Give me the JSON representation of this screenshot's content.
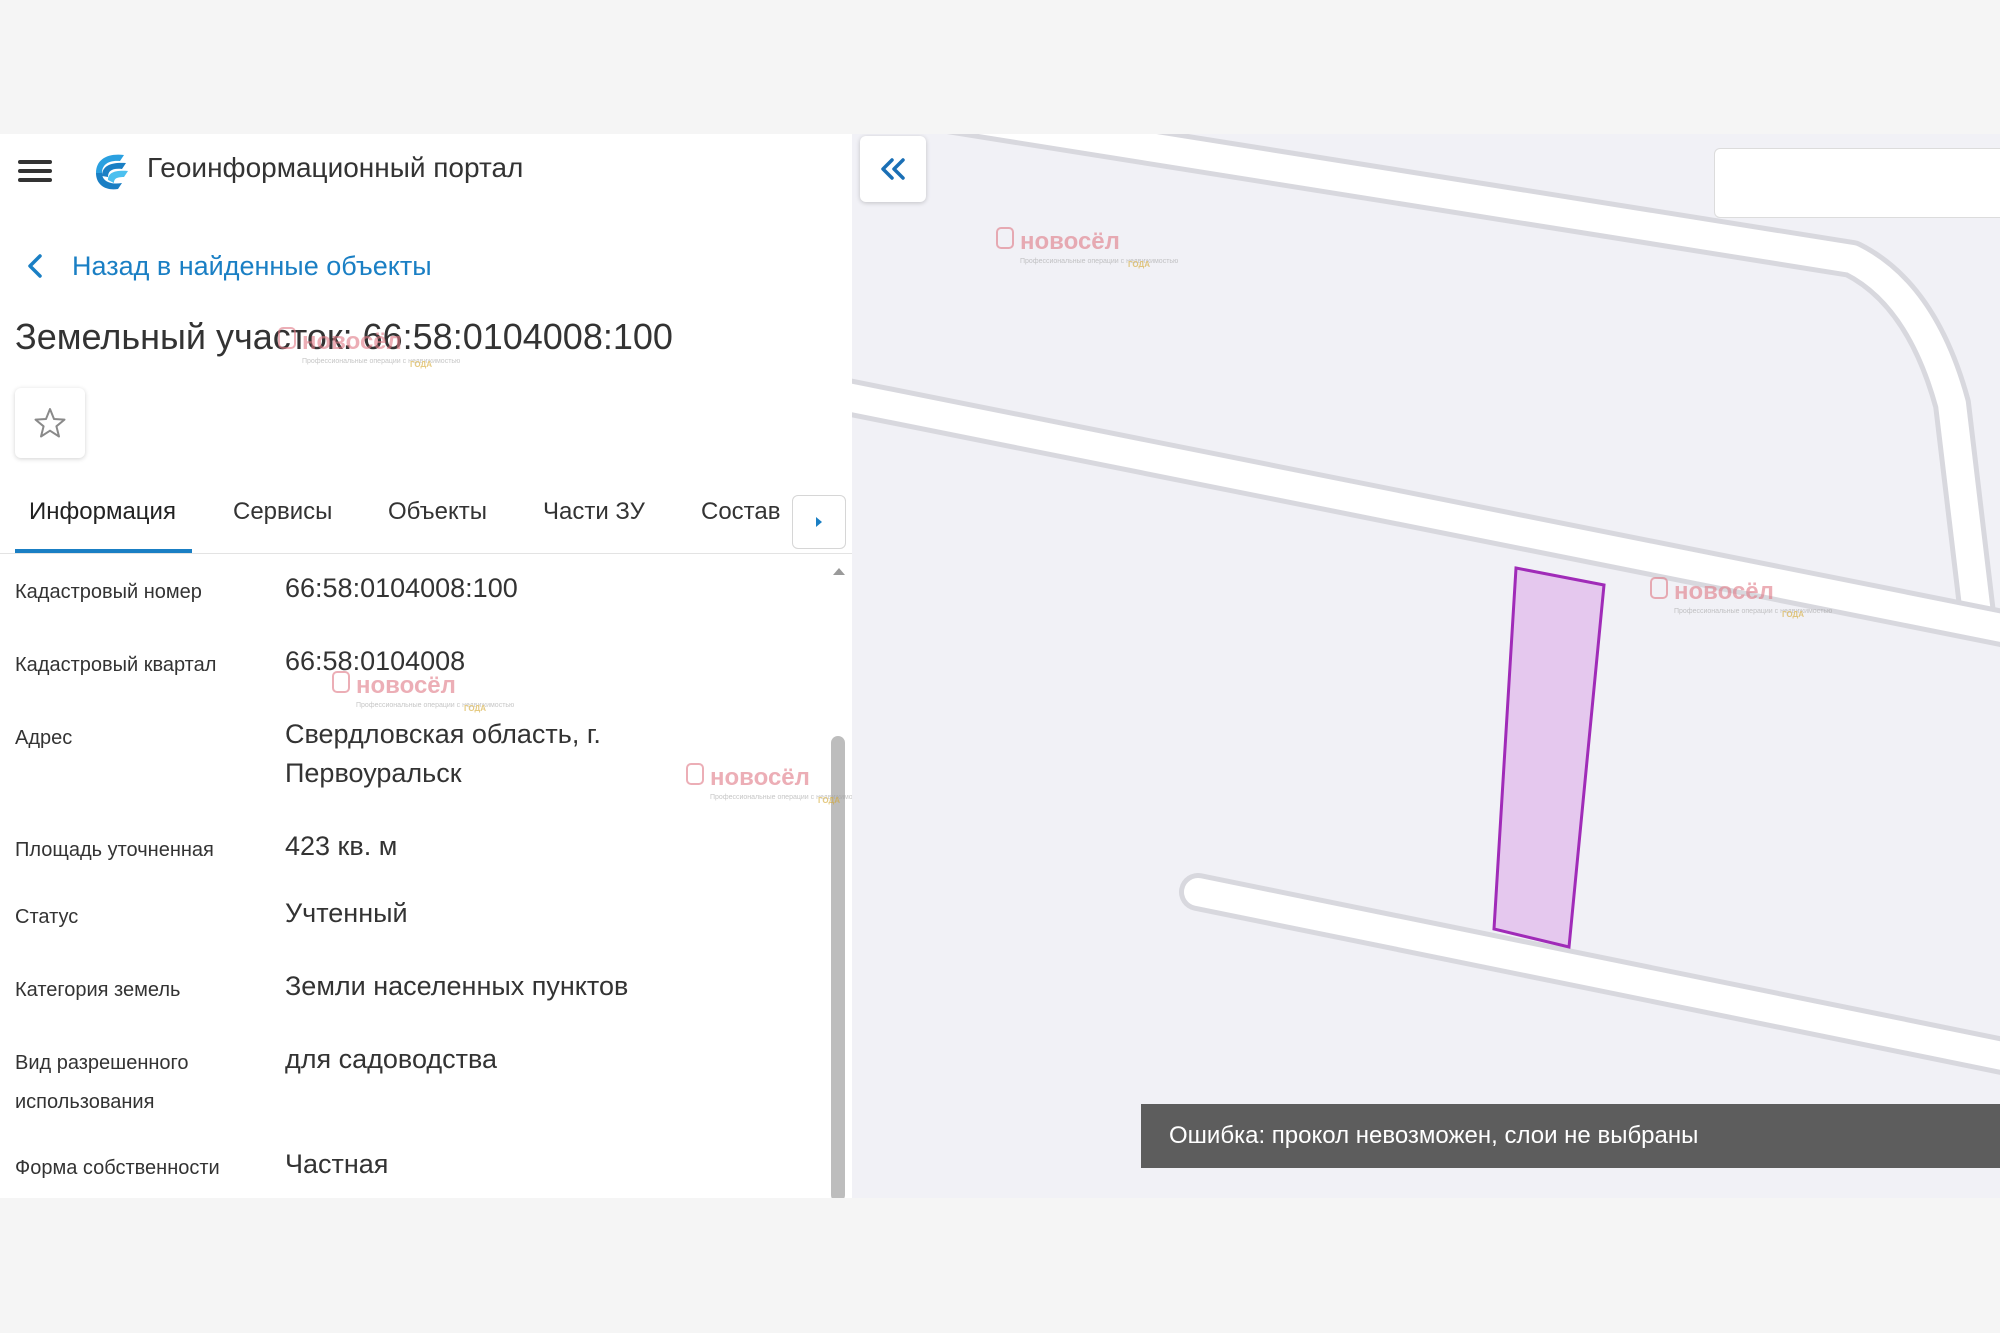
{
  "app": {
    "title": "Геоинформационный портал"
  },
  "nav": {
    "back_label": "Назад в найденные объекты"
  },
  "object": {
    "title": "Земельный участок: 66:58:0104008:100"
  },
  "tabs": [
    {
      "label": "Информация",
      "active": true
    },
    {
      "label": "Сервисы",
      "active": false
    },
    {
      "label": "Объекты",
      "active": false
    },
    {
      "label": "Части ЗУ",
      "active": false
    },
    {
      "label": "Состав",
      "active": false
    }
  ],
  "info": {
    "rows": [
      {
        "label": "Кадастровый номер",
        "value": "66:58:0104008:100"
      },
      {
        "label": "Кадастровый квартал",
        "value": "66:58:0104008"
      },
      {
        "label": "Адрес",
        "value_line1": "Свердловская область, г.",
        "value_line2": "Первоуральск"
      },
      {
        "label": "Площадь уточненная",
        "value": "423 кв. м"
      },
      {
        "label": "Статус",
        "value": "Учтенный"
      },
      {
        "label": "Категория земель",
        "value": "Земли населенных пунктов"
      },
      {
        "label_line1": "Вид разрешенного",
        "label_line2": "использования",
        "value": "для садоводства"
      },
      {
        "label": "Форма собственности",
        "value": "Частная"
      }
    ]
  },
  "map": {
    "search_value": "",
    "parcel_fill": "#e5c8ee",
    "parcel_stroke": "#a02bb8"
  },
  "toast": {
    "message": "Ошибка: прокол невозможен, слои не выбраны"
  },
  "watermark": {
    "brand": "новосёл",
    "tagline": "Профессиональные операции с недвижимостью",
    "badge": "ГОДА"
  },
  "icons": {
    "menu": "hamburger-icon",
    "logo": "portal-logo-icon",
    "back": "chevron-left-icon",
    "favorite": "star-outline-icon",
    "tabs_next": "caret-right-icon",
    "collapse": "double-chevron-left-icon"
  },
  "colors": {
    "accent": "#1a7fc4",
    "toast_bg": "#5d5d5d",
    "map_bg": "#f1f1f6"
  }
}
